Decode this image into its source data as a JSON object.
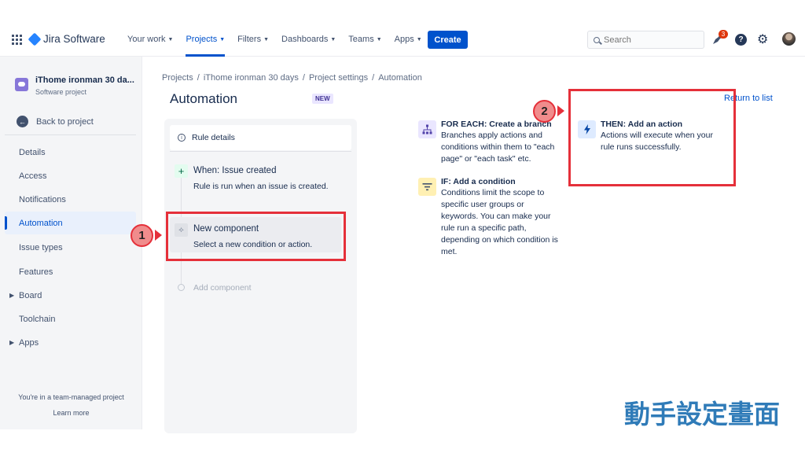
{
  "topnav": {
    "product": "Jira Software",
    "items": [
      {
        "label": "Your work"
      },
      {
        "label": "Projects"
      },
      {
        "label": "Filters"
      },
      {
        "label": "Dashboards"
      },
      {
        "label": "Teams"
      },
      {
        "label": "Apps"
      }
    ],
    "create_label": "Create",
    "search_placeholder": "Search",
    "notification_count": "3",
    "help_label": "?"
  },
  "sidebar": {
    "project_name": "iThome ironman 30 da...",
    "project_type": "Software project",
    "back_label": "Back to project",
    "items": [
      {
        "label": "Details"
      },
      {
        "label": "Access"
      },
      {
        "label": "Notifications"
      },
      {
        "label": "Automation"
      },
      {
        "label": "Issue types"
      },
      {
        "label": "Features"
      },
      {
        "label": "Board"
      },
      {
        "label": "Toolchain"
      },
      {
        "label": "Apps"
      }
    ],
    "team_note": "You're in a team-managed project",
    "learn_more": "Learn more"
  },
  "breadcrumb": [
    "Projects",
    "/",
    "iThome ironman 30 days",
    "/",
    "Project settings",
    "/",
    "Automation"
  ],
  "page": {
    "title": "Automation",
    "badge": "NEW",
    "return_link": "Return to list"
  },
  "rule": {
    "details_label": "Rule details",
    "trigger_title": "When: Issue created",
    "trigger_desc": "Rule is run when an issue is created.",
    "new_component_title": "New component",
    "new_component_desc": "Select a new condition or action.",
    "add_component": "Add component"
  },
  "options": {
    "for_each_title": "FOR EACH: Create a branch",
    "for_each_desc": [
      "Branches apply actions and",
      "conditions within them to \"each",
      "page\" or \"each task\" etc."
    ],
    "if_title": "IF: Add a condition",
    "if_desc": [
      "Conditions limit the scope to",
      "specific user groups or",
      "keywords. You can make your",
      "rule run a specific path,",
      "depending on which condition is",
      "met."
    ],
    "then_title": "THEN: Add an action",
    "then_desc": [
      "Actions will execute when your",
      "rule runs successfully."
    ]
  },
  "annotations": {
    "step1": "1",
    "step2": "2",
    "caption": "動手設定畫面",
    "accent_color": "#e5303a",
    "caption_color": "#2f7bb8"
  }
}
